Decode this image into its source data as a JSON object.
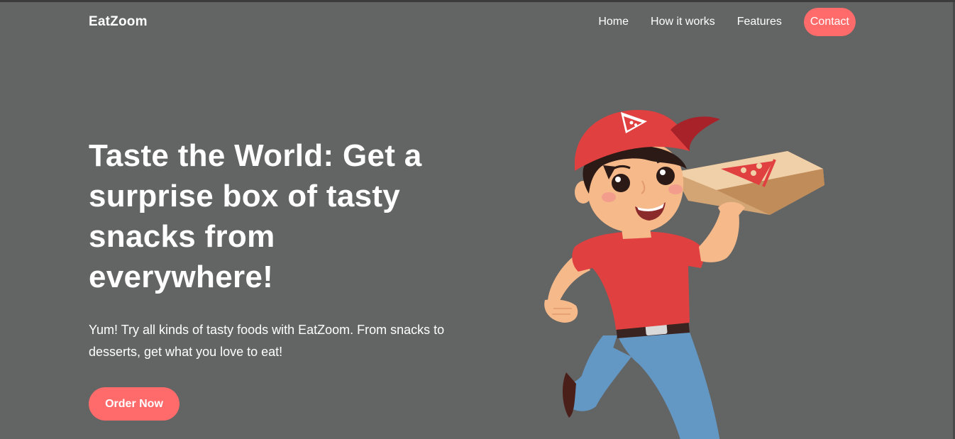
{
  "header": {
    "brand": "EatZoom",
    "nav": [
      {
        "label": "Home"
      },
      {
        "label": "How it works"
      },
      {
        "label": "Features"
      },
      {
        "label": "Contact"
      }
    ]
  },
  "hero": {
    "title": "Taste the World: Get a surprise box of tasty snacks from everywhere!",
    "subtitle": "Yum! Try all kinds of tasty foods with EatZoom. From snacks to desserts, get what you love to eat!",
    "cta_label": "Order Now",
    "illustration_icon": "pizza-delivery-boy-illustration"
  },
  "colors": {
    "background": "#636464",
    "accent": "#ff6b6b",
    "text": "#ffffff"
  }
}
